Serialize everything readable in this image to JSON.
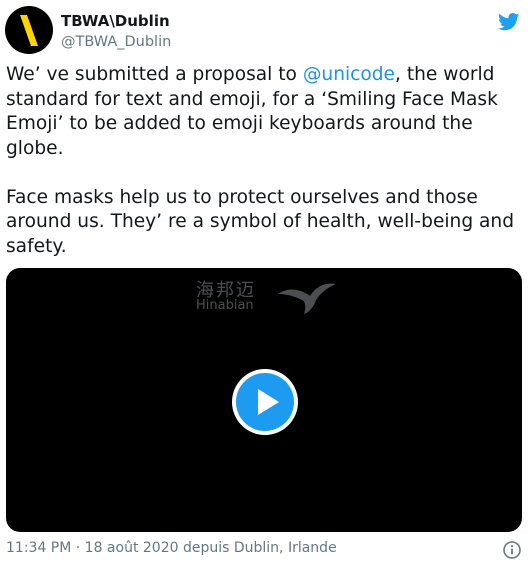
{
  "author": {
    "display_name": "TBWA\\Dublin",
    "handle": "@TBWA_Dublin",
    "avatar_icon": "tbwa-slash-logo"
  },
  "tweet": {
    "p1_before": "We’ ve submitted a proposal to ",
    "p1_mention": "@unicode",
    "p1_after": ", the world standard for text and emoji, for a ‘Smiling Face Mask Emoji’ to be added to emoji keyboards around the globe.",
    "p2": "Face masks help us to protect ourselves and those around us. They’ re a symbol of health, well-being and safety."
  },
  "media": {
    "watermark_cn": "海邦迈",
    "watermark_en": "Hinabian",
    "play_icon": "play-icon"
  },
  "footer": {
    "timestamp": "11:34 PM · 18 août 2020 depuis Dublin, Irlande",
    "info_icon": "info-icon"
  },
  "colors": {
    "link": "#1b95e0",
    "twitter_blue": "#1d9bf0",
    "logo_yellow": "#ffd400",
    "muted": "#657786"
  }
}
